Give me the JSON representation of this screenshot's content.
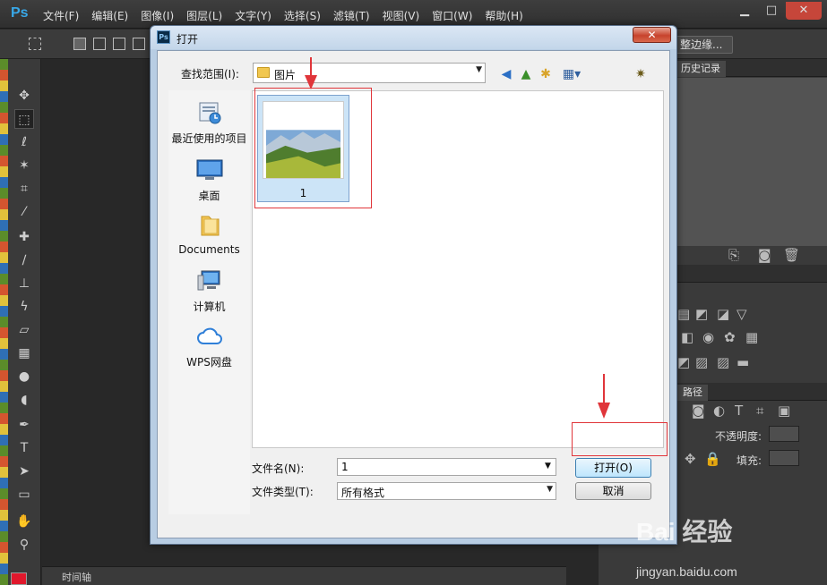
{
  "app": {
    "logo": "Ps",
    "menus": [
      "文件(F)",
      "编辑(E)",
      "图像(I)",
      "图层(L)",
      "文字(Y)",
      "选择(S)",
      "滤镜(T)",
      "视图(V)",
      "窗口(W)",
      "帮助(H)"
    ],
    "window_controls": {
      "minimize": "▁",
      "maximize": "□",
      "close": "✕"
    },
    "options_bar": {
      "refine_edge_label": "整边缘..."
    },
    "timeline_label": "时间轴",
    "history_tab": "历史记录",
    "paths_tab": "路径",
    "opacity_label": "不透明度:",
    "fill_label": "填充:",
    "foreground_color": "#e0182c"
  },
  "dialog": {
    "title": "打开",
    "icon_text": "Ps",
    "close_glyph": "✕",
    "look_in_label": "查找范围(I):",
    "look_in_value": "图片",
    "places": [
      {
        "label": "最近使用的项目",
        "icon": "recent-items-icon"
      },
      {
        "label": "桌面",
        "icon": "desktop-icon"
      },
      {
        "label": "Documents",
        "icon": "documents-folder-icon"
      },
      {
        "label": "计算机",
        "icon": "computer-icon"
      },
      {
        "label": "WPS网盘",
        "icon": "wps-cloud-icon"
      }
    ],
    "files": [
      {
        "name": "1",
        "icon": "landscape-thumbnail"
      }
    ],
    "file_name_label": "文件名(N):",
    "file_name_value": "1",
    "file_type_label": "文件类型(T):",
    "file_type_value": "所有格式",
    "open_button": "打开(O)",
    "cancel_button": "取消"
  },
  "watermark": {
    "brand": "Bai 经验",
    "url": "jingyan.baidu.com"
  },
  "colors": {
    "annotation": "#e0353a",
    "selection": "#cce4f7",
    "ps_blue": "#38a8e8"
  }
}
